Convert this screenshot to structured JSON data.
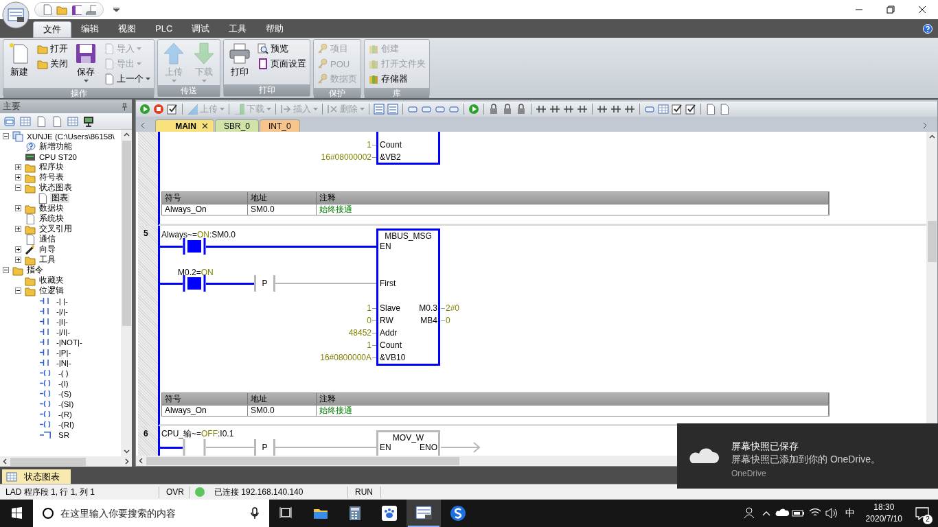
{
  "ribbon": {
    "tabs": [
      {
        "label": "文件",
        "selected": true
      },
      {
        "label": "编辑",
        "selected": false
      },
      {
        "label": "视图",
        "selected": false
      },
      {
        "label": "PLC",
        "selected": false
      },
      {
        "label": "调试",
        "selected": false
      },
      {
        "label": "工具",
        "selected": false
      },
      {
        "label": "帮助",
        "selected": false
      }
    ],
    "groups": [
      {
        "label": "操作",
        "items": [
          {
            "label": "新建",
            "kind": "large",
            "disabled": false,
            "dropdown": false
          },
          {
            "label": "打开",
            "kind": "small",
            "disabled": false,
            "dropdown": false
          },
          {
            "label": "关闭",
            "kind": "small",
            "disabled": false,
            "dropdown": false
          },
          {
            "label": "保存",
            "kind": "large",
            "disabled": false,
            "dropdown": true
          },
          {
            "label": "导入",
            "kind": "small",
            "disabled": true,
            "dropdown": true
          },
          {
            "label": "导出",
            "kind": "small",
            "disabled": true,
            "dropdown": true
          },
          {
            "label": "上一个",
            "kind": "small",
            "disabled": false,
            "dropdown": true
          }
        ]
      },
      {
        "label": "传送",
        "items": [
          {
            "label": "上传",
            "kind": "large",
            "disabled": true,
            "dropdown": true
          },
          {
            "label": "下载",
            "kind": "large",
            "disabled": true,
            "dropdown": true
          }
        ]
      },
      {
        "label": "打印",
        "items": [
          {
            "label": "打印",
            "kind": "large",
            "disabled": false,
            "dropdown": false
          },
          {
            "label": "预览",
            "kind": "small",
            "disabled": false,
            "dropdown": false
          },
          {
            "label": "页面设置",
            "kind": "small",
            "disabled": false,
            "dropdown": false
          }
        ]
      },
      {
        "label": "保护",
        "items": [
          {
            "label": "项目",
            "kind": "small",
            "disabled": true,
            "dropdown": false
          },
          {
            "label": "POU",
            "kind": "small",
            "disabled": true,
            "dropdown": false
          },
          {
            "label": "数据页",
            "kind": "small",
            "disabled": true,
            "dropdown": false
          }
        ]
      },
      {
        "label": "库",
        "items": [
          {
            "label": "创建",
            "kind": "small",
            "disabled": true,
            "dropdown": false
          },
          {
            "label": "打开文件夹",
            "kind": "small",
            "disabled": true,
            "dropdown": false
          },
          {
            "label": "存储器",
            "kind": "small",
            "disabled": false,
            "dropdown": false
          }
        ]
      }
    ]
  },
  "navigator": {
    "title": "主要",
    "tree": [
      {
        "label": "XUNJE (C:\\Users\\86158\\",
        "kind": "project",
        "expanded": true,
        "selected": false,
        "children": [
          {
            "label": "新增功能",
            "kind": "help",
            "selected": false
          },
          {
            "label": "CPU ST20",
            "kind": "cpu",
            "selected": false
          },
          {
            "label": "程序块",
            "kind": "folder",
            "expanded": false,
            "selected": false
          },
          {
            "label": "符号表",
            "kind": "folder",
            "expanded": false,
            "selected": false
          },
          {
            "label": "状态图表",
            "kind": "folder",
            "expanded": true,
            "selected": false,
            "children": [
              {
                "label": "图表",
                "kind": "table",
                "selected": true
              }
            ]
          },
          {
            "label": "数据块",
            "kind": "folder",
            "expanded": false,
            "selected": false
          },
          {
            "label": "系统块",
            "kind": "doc",
            "selected": false
          },
          {
            "label": "交叉引用",
            "kind": "folder",
            "expanded": false,
            "selected": false
          },
          {
            "label": "通信",
            "kind": "comm",
            "selected": false
          },
          {
            "label": "向导",
            "kind": "wizard",
            "expanded": false,
            "selected": false
          },
          {
            "label": "工具",
            "kind": "folder",
            "expanded": false,
            "selected": false
          }
        ]
      },
      {
        "label": "指令",
        "kind": "folder",
        "expanded": true,
        "selected": false,
        "children": [
          {
            "label": "收藏夹",
            "kind": "folder",
            "selected": false
          },
          {
            "label": "位逻辑",
            "kind": "folder",
            "expanded": true,
            "selected": false,
            "children": [
              {
                "label": "-| |-",
                "kind": "contact",
                "selected": false
              },
              {
                "label": "-|/|-",
                "kind": "contact",
                "selected": false
              },
              {
                "label": "-|I|-",
                "kind": "contact",
                "selected": false
              },
              {
                "label": "-|/I|-",
                "kind": "contact",
                "selected": false
              },
              {
                "label": "-|NOT|-",
                "kind": "contact",
                "selected": false
              },
              {
                "label": "-|P|-",
                "kind": "contact",
                "selected": false
              },
              {
                "label": "-|N|-",
                "kind": "contact",
                "selected": false
              },
              {
                "label": "-( )",
                "kind": "coil",
                "selected": false
              },
              {
                "label": "-(I)",
                "kind": "coil",
                "selected": false
              },
              {
                "label": "-(S)",
                "kind": "coil",
                "selected": false
              },
              {
                "label": "-(SI)",
                "kind": "coil",
                "selected": false
              },
              {
                "label": "-(R)",
                "kind": "coil",
                "selected": false
              },
              {
                "label": "-(RI)",
                "kind": "coil",
                "selected": false
              },
              {
                "label": "SR",
                "kind": "box",
                "selected": false
              }
            ]
          }
        ]
      }
    ]
  },
  "editor": {
    "toolbar": [
      {
        "label": "上传",
        "disabled": true
      },
      {
        "label": "下载",
        "disabled": true
      },
      {
        "label": "插入",
        "disabled": true
      },
      {
        "label": "删除",
        "disabled": true
      }
    ],
    "tabs": [
      {
        "label": "MAIN",
        "selected": true,
        "color": "#f8e07a"
      },
      {
        "label": "SBR_0",
        "selected": false,
        "color": "#d2e3a8"
      },
      {
        "label": "INT_0",
        "selected": false,
        "color": "#f7c48c"
      }
    ],
    "networks": [
      {
        "kind": "tail",
        "box": {
          "powered": true,
          "pins": [
            {
              "value": "1",
              "pin": "Count"
            },
            {
              "value": "16#08000002",
              "pin": "&VB2"
            }
          ]
        },
        "symbols": {
          "columns": [
            "符号",
            "地址",
            "注释"
          ],
          "rows": [
            [
              "Always_On",
              "SM0.0",
              "始终接通"
            ]
          ]
        }
      },
      {
        "kind": "mbus",
        "number": "5",
        "contacts": [
          {
            "operand": "Always~=",
            "value": "ON",
            "address": ":SM0.0",
            "powered": true
          },
          {
            "operand": "M0.2=",
            "value": "ON",
            "powered": true
          }
        ],
        "edge": {
          "label": "P",
          "powered": false
        },
        "box": {
          "title": "MBUS_MSG",
          "powered": true,
          "pins": [
            {
              "pin": "EN"
            },
            {
              "pin": "First"
            },
            {
              "value": "1",
              "pin": "Slave"
            },
            {
              "value": "0",
              "pin": "RW"
            },
            {
              "value": "48452",
              "pin": "Addr"
            },
            {
              "value": "1",
              "pin": "Count"
            },
            {
              "value": "16#0800000A",
              "pin": "&VB10"
            }
          ],
          "outputs": [
            {
              "pin": "M0.3",
              "value": "2#0"
            },
            {
              "pin": "MB4",
              "value": "0"
            }
          ]
        },
        "symbols": {
          "columns": [
            "符号",
            "地址",
            "注释"
          ],
          "rows": [
            [
              "Always_On",
              "SM0.0",
              "始终接通"
            ]
          ]
        }
      },
      {
        "kind": "mov",
        "number": "6",
        "contacts": [
          {
            "operand": "CPU_输~=",
            "value": "OFF",
            "address": ":I0.1",
            "powered": false
          }
        ],
        "edge": {
          "label": "P",
          "powered": false
        },
        "box": {
          "title": "MOV_W",
          "powered": false,
          "pins": [
            {
              "pin": "EN"
            }
          ],
          "outputs": [
            {
              "pin": "ENO"
            }
          ]
        }
      }
    ]
  },
  "bottom_tabs": [
    {
      "label": "状态图表",
      "selected": true
    }
  ],
  "status_bar": {
    "position": "LAD 程序段 1, 行 1, 列 1",
    "mode": "OVR",
    "connected": true,
    "connection": "已连接 192.168.140.140",
    "plc_state": "RUN"
  },
  "taskbar": {
    "search_placeholder": "在这里输入你要搜索的内容",
    "ime": "中",
    "time": "18:30",
    "date": "2020/7/10",
    "notifications": "2"
  },
  "toast": {
    "title": "屏幕快照已保存",
    "body": "屏幕快照已添加到你的 OneDrive。",
    "source": "OneDrive"
  }
}
